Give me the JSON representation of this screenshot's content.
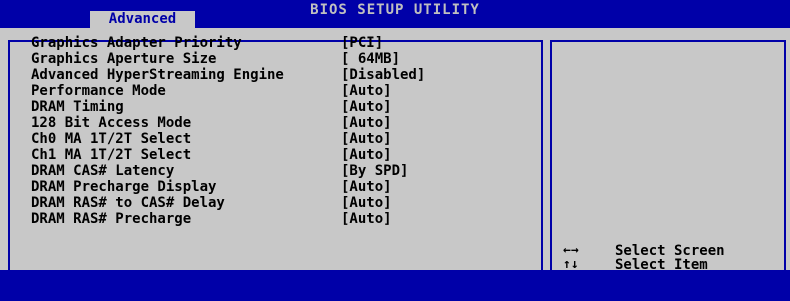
{
  "header": {
    "title": "BIOS SETUP UTILITY",
    "active_tab": "Advanced"
  },
  "settings": [
    {
      "label": "Graphics Adapter Priority",
      "value": "[PCI]"
    },
    {
      "label": "Graphics Aperture Size",
      "value": "[ 64MB]"
    },
    {
      "label": "Advanced HyperStreaming Engine",
      "value": "[Disabled]"
    },
    {
      "label": "Performance Mode",
      "value": "[Auto]"
    },
    {
      "label": "DRAM Timing",
      "value": "[Auto]"
    },
    {
      "label": "128 Bit Access Mode",
      "value": "[Auto]"
    },
    {
      "label": "Ch0 MA 1T/2T Select",
      "value": "[Auto]"
    },
    {
      "label": "Ch1 MA 1T/2T Select",
      "value": "[Auto]"
    },
    {
      "label": "DRAM CAS# Latency",
      "value": "[By SPD]"
    },
    {
      "label": "DRAM Precharge Display",
      "value": "[Auto]"
    },
    {
      "label": "DRAM RAS# to CAS# Delay",
      "value": "[Auto]"
    },
    {
      "label": "DRAM RAS# Precharge",
      "value": "[Auto]"
    }
  ],
  "help": [
    {
      "key_icon": "left-right-arrows-icon",
      "key": "←→",
      "text": "Select Screen"
    },
    {
      "key_icon": "up-down-arrows-icon",
      "key": "↑↓",
      "text": "Select Item"
    }
  ],
  "colors": {
    "bios_blue": "#0000a8",
    "panel_gray": "#c8c8c8",
    "title_gray": "#c0c0c0",
    "text_black": "#000000"
  }
}
